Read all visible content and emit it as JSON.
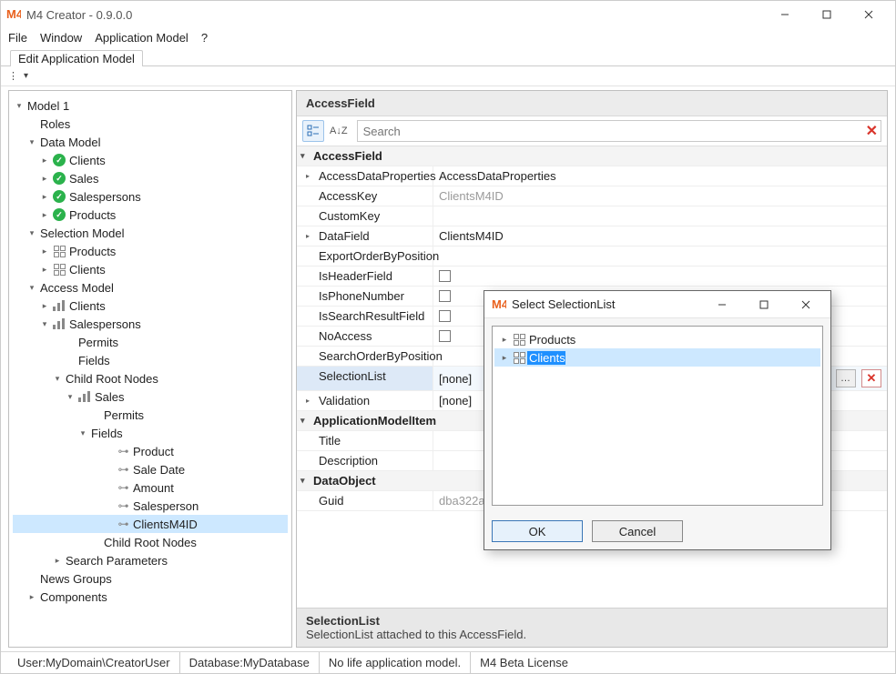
{
  "window": {
    "title": "M4 Creator - 0.9.0.0",
    "logo_text": "M4"
  },
  "menu": {
    "file": "File",
    "window": "Window",
    "app_model": "Application Model",
    "help": "?"
  },
  "tab": {
    "label": "Edit Application Model"
  },
  "tree": {
    "root": "Model 1",
    "roles": "Roles",
    "data_model": "Data Model",
    "dm_clients": "Clients",
    "dm_sales": "Sales",
    "dm_salespersons": "Salespersons",
    "dm_products": "Products",
    "selection_model": "Selection Model",
    "sm_products": "Products",
    "sm_clients": "Clients",
    "access_model": "Access Model",
    "am_clients": "Clients",
    "am_salespersons": "Salespersons",
    "permits": "Permits",
    "fields": "Fields",
    "child_root_nodes": "Child Root Nodes",
    "crn_sales": "Sales",
    "crn_permits": "Permits",
    "crn_fields": "Fields",
    "f_product": "Product",
    "f_saledate": "Sale Date",
    "f_amount": "Amount",
    "f_salesperson": "Salesperson",
    "f_clientsm4id": "ClientsM4ID",
    "crn_child_root_nodes": "Child Root Nodes",
    "search_params": "Search Parameters",
    "news_groups": "News Groups",
    "components": "Components"
  },
  "panel": {
    "title": "AccessField",
    "search_placeholder": "Search",
    "sort_label": "A↓Z"
  },
  "props": {
    "cat_accessfield": "AccessField",
    "accessdataproperties": {
      "name": "AccessDataProperties",
      "value": "AccessDataProperties"
    },
    "accesskey": {
      "name": "AccessKey",
      "value": "ClientsM4ID"
    },
    "customkey": {
      "name": "CustomKey",
      "value": ""
    },
    "datafield": {
      "name": "DataField",
      "value": "ClientsM4ID"
    },
    "exportorder": {
      "name": "ExportOrderByPosition",
      "value": ""
    },
    "isheader": {
      "name": "IsHeaderField"
    },
    "isphone": {
      "name": "IsPhoneNumber"
    },
    "issearchresult": {
      "name": "IsSearchResultField"
    },
    "noaccess": {
      "name": "NoAccess"
    },
    "searchorder": {
      "name": "SearchOrderByPosition",
      "value": ""
    },
    "selectionlist": {
      "name": "SelectionList",
      "value": "[none]"
    },
    "validation": {
      "name": "Validation",
      "value": "[none]"
    },
    "cat_appmodelitem": "ApplicationModelItem",
    "title": {
      "name": "Title",
      "value": ""
    },
    "description": {
      "name": "Description",
      "value": ""
    },
    "cat_dataobject": "DataObject",
    "guid": {
      "name": "Guid",
      "value": "dba322a"
    }
  },
  "propfoot": {
    "title": "SelectionList",
    "desc": "SelectionList attached to this AccessField."
  },
  "dialog": {
    "title": "Select SelectionList",
    "item_products": "Products",
    "item_clients": "Clients",
    "ok": "OK",
    "cancel": "Cancel"
  },
  "status": {
    "user_label": "User: ",
    "user": "MyDomain\\CreatorUser",
    "db_label": "Database: ",
    "db": "MyDatabase",
    "life": "No life application model.",
    "license": "M4 Beta License"
  }
}
